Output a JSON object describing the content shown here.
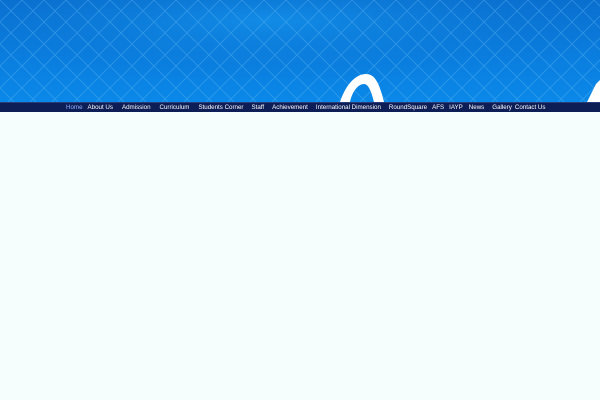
{
  "nav": {
    "items": [
      {
        "label": "Home",
        "active": true
      },
      {
        "label": "About Us"
      },
      {
        "label": "Admission"
      },
      {
        "label": "Curriculum"
      },
      {
        "label": "Students Corner"
      },
      {
        "label": "Staff"
      },
      {
        "label": "Achievement"
      },
      {
        "label": "International Dimension"
      },
      {
        "label": "RoundSquare"
      },
      {
        "label": "AFS"
      },
      {
        "label": "IAYP"
      },
      {
        "label": "News"
      },
      {
        "label": "Gallery"
      },
      {
        "label": "Contact Us"
      }
    ]
  },
  "colors": {
    "banner_blue": "#0a7fe0",
    "navbar_navy": "#0d1e57",
    "active_link": "#8fb3ff",
    "page_background": "#f5fdfd"
  }
}
